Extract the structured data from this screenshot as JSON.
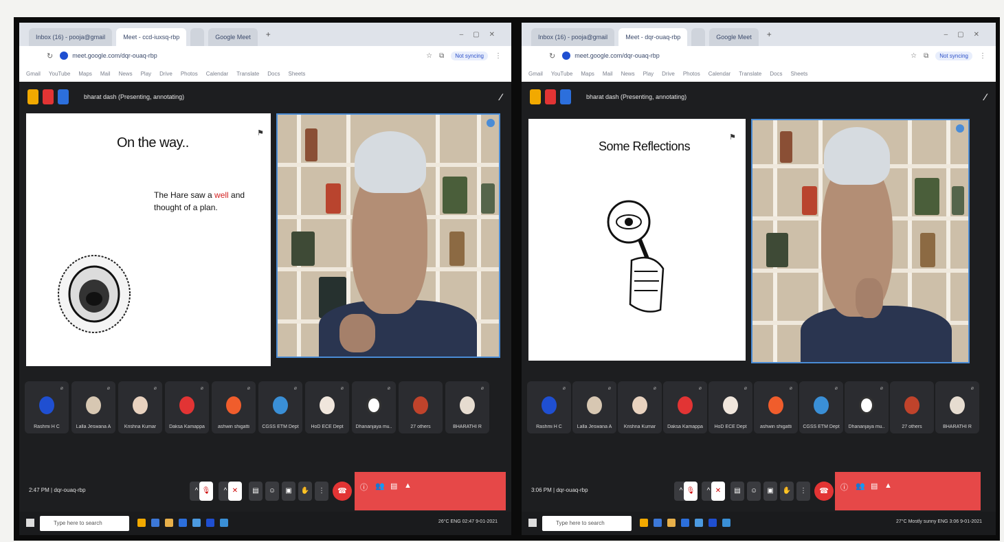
{
  "screens": [
    {
      "tabs": [
        "Inbox (16) - pooja@gmail",
        "Meet - ccd-iuxsq-rbp",
        "",
        "Google Meet"
      ],
      "url": "meet.google.com/dqr-ouaq-rbp",
      "profile": "Not syncing",
      "bookmarks": [
        "Gmail",
        "YouTube",
        "Maps",
        "Mail",
        "News",
        "Play",
        "Drive",
        "Photos",
        "Calendar",
        "Translate",
        "Docs",
        "Sheets"
      ],
      "presenter": "bharat dash (Presenting, annotating)",
      "slide": {
        "title": "On the way..",
        "body_pre": "The Hare saw a ",
        "body_red": "well",
        "body_post": " and thought of a plan."
      },
      "participants": [
        "Rashmi H C",
        "Lalla Jeswana A",
        "Krishna Kumar",
        "Daksa Kamappa",
        "ashwin shigatti",
        "CGSS ETM Dept",
        "HoD ECE Dept",
        "Dhananjaya mu..",
        "27 others",
        "BHARATHI R"
      ],
      "meeting": {
        "time": "2:47 PM",
        "code": "dqr-ouaq-rbp"
      },
      "taskbar": {
        "search": "Type here to search",
        "right": "26°C  ENG  02:47  9-01-2021"
      }
    },
    {
      "tabs": [
        "Inbox (16) - pooja@gmail",
        "Meet - dqr-ouaq-rbp",
        "",
        "Google Meet"
      ],
      "url": "meet.google.com/dqr-ouaq-rbp",
      "profile": "Not syncing",
      "bookmarks": [
        "Gmail",
        "YouTube",
        "Maps",
        "Mail",
        "News",
        "Play",
        "Drive",
        "Photos",
        "Calendar",
        "Translate",
        "Docs",
        "Sheets"
      ],
      "presenter": "bharat dash (Presenting, annotating)",
      "slide": {
        "title": "Some Reflections"
      },
      "participants": [
        "Rashmi H C",
        "Lalla Jeswana A",
        "Krishna Kumar",
        "Daksa Kamappa",
        "HoD ECE Dept",
        "ashwin shigatti",
        "CGSS ETM Dept",
        "Dhananjaya mu..",
        "27 others",
        "BHARATHI R"
      ],
      "meeting": {
        "time": "3:06 PM",
        "code": "dqr-ouaq-rbp"
      },
      "taskbar": {
        "search": "Type here to search",
        "right": "27°C  Mostly sunny  ENG  3:06  9-01-2021"
      }
    }
  ]
}
